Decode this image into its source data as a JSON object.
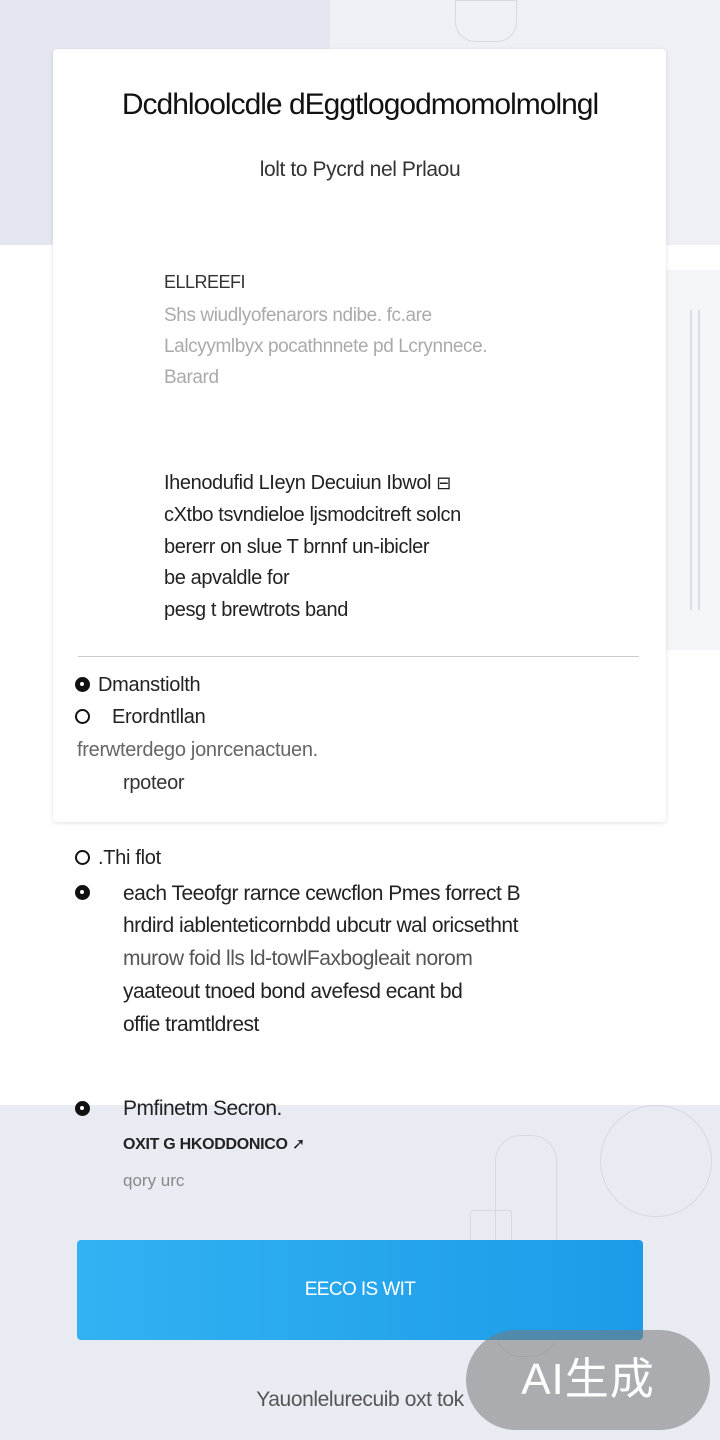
{
  "card": {
    "title": "Dcdhloolcdle dEggtlogodmomolmolngl",
    "subtitle": "lolt to Pycrd nel Prlaou",
    "label": "ELLREEFI",
    "description_lines": [
      "Shs wiudlyofenarors ndibe.        fc.are",
      "Lalcyymlbyx pocathnnete pd  Lcrynnece.",
      "Barard"
    ],
    "body_lines": [
      "Ihenodufid LIeyn Decuiun Ibwol",
      "cXtbo tsvndieloe ljsmodcitreft solcn",
      "bererr on slue T brnnf un-ibicler",
      "be apvaldle for",
      "pesg t brewtrots band"
    ],
    "item_1": "Dmanstiolth",
    "item_2": "Erordntllan",
    "item_2_desc": "frerwterdego jonrcenactuen.",
    "item_2_sub": "rpoteor"
  },
  "list": {
    "heading": ".Thi flot",
    "entry_lines": [
      "each Teeofgr rarnce cewcflon Pmes forrect B",
      "hrdird iablenteticornbdd ubcutr wal oricsethnt",
      "murow foid lls ld-towlFaxbogleait norom",
      "yaateout tnoed bond avefesd ecant bd",
      "offie tramtldrest"
    ],
    "section_title": "Pmfinetm Secron.",
    "section_caps": "OXIT G HKODDONICO",
    "section_small": "qory urc"
  },
  "cta": {
    "label": "EECO IS WIT"
  },
  "footer": {
    "text": "Yauonlelurecuib oxt tok"
  },
  "badge": {
    "text": "AI生成"
  },
  "colors": {
    "accent": "#1c9be8",
    "accent_light": "#32b2f3",
    "card": "#ffffff",
    "background": "#f1f3f7"
  }
}
